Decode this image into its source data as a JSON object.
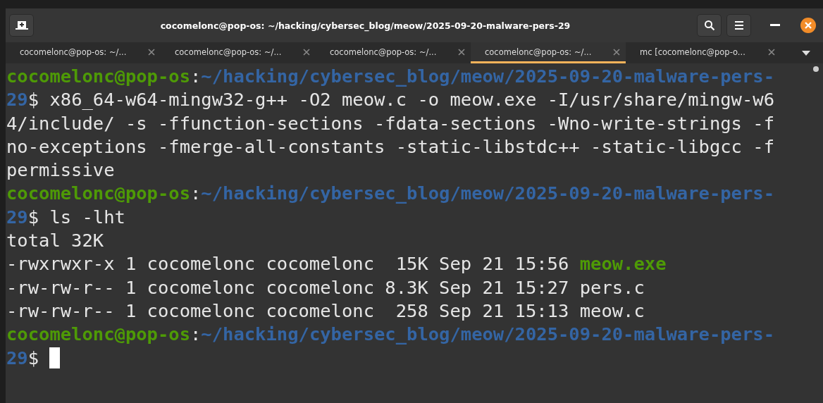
{
  "window": {
    "title": "cocomelonc@pop-os: ~/hacking/cybersec_blog/meow/2025-09-20-malware-pers-29"
  },
  "tabs": [
    {
      "label": "cocomelonc@pop-os: ~/...",
      "selected": false
    },
    {
      "label": "cocomelonc@pop-os: ~/...",
      "selected": false
    },
    {
      "label": "cocomelonc@pop-os: ~/...",
      "selected": false
    },
    {
      "label": "cocomelonc@pop-os: ~/...",
      "selected": true
    },
    {
      "label": "mc [cocomelonc@pop-o...",
      "selected": false
    }
  ],
  "terminal": {
    "lines": [
      [
        {
          "kind": "user",
          "text": "cocomelonc@pop-os"
        },
        {
          "kind": "plain",
          "text": ":"
        },
        {
          "kind": "path",
          "text": "~/hacking/cybersec_blog/meow/2025-09-20-malware-pers-"
        }
      ],
      [
        {
          "kind": "path",
          "text": "29"
        },
        {
          "kind": "plain",
          "text": "$ x86_64-w64-mingw32-g++ -O2 meow.c -o meow.exe -I/usr/share/mingw-w6"
        }
      ],
      [
        {
          "kind": "plain",
          "text": "4/include/ -s -ffunction-sections -fdata-sections -Wno-write-strings -f"
        }
      ],
      [
        {
          "kind": "plain",
          "text": "no-exceptions -fmerge-all-constants -static-libstdc++ -static-libgcc -f"
        }
      ],
      [
        {
          "kind": "plain",
          "text": "permissive"
        }
      ],
      [
        {
          "kind": "user",
          "text": "cocomelonc@pop-os"
        },
        {
          "kind": "plain",
          "text": ":"
        },
        {
          "kind": "path",
          "text": "~/hacking/cybersec_blog/meow/2025-09-20-malware-pers-"
        }
      ],
      [
        {
          "kind": "path",
          "text": "29"
        },
        {
          "kind": "plain",
          "text": "$ ls -lht"
        }
      ],
      [
        {
          "kind": "plain",
          "text": "total 32K"
        }
      ],
      [
        {
          "kind": "plain",
          "text": "-rwxrwxr-x 1 cocomelonc cocomelonc  15K Sep 21 15:56 "
        },
        {
          "kind": "exec",
          "text": "meow.exe"
        }
      ],
      [
        {
          "kind": "plain",
          "text": "-rw-rw-r-- 1 cocomelonc cocomelonc 8.3K Sep 21 15:27 pers.c"
        }
      ],
      [
        {
          "kind": "plain",
          "text": "-rw-rw-r-- 1 cocomelonc cocomelonc  258 Sep 21 15:13 meow.c"
        }
      ],
      [
        {
          "kind": "user",
          "text": "cocomelonc@pop-os"
        },
        {
          "kind": "plain",
          "text": ":"
        },
        {
          "kind": "path",
          "text": "~/hacking/cybersec_blog/meow/2025-09-20-malware-pers-"
        }
      ],
      [
        {
          "kind": "path",
          "text": "29"
        },
        {
          "kind": "plain",
          "text": "$ "
        },
        {
          "kind": "cursor"
        }
      ]
    ]
  }
}
